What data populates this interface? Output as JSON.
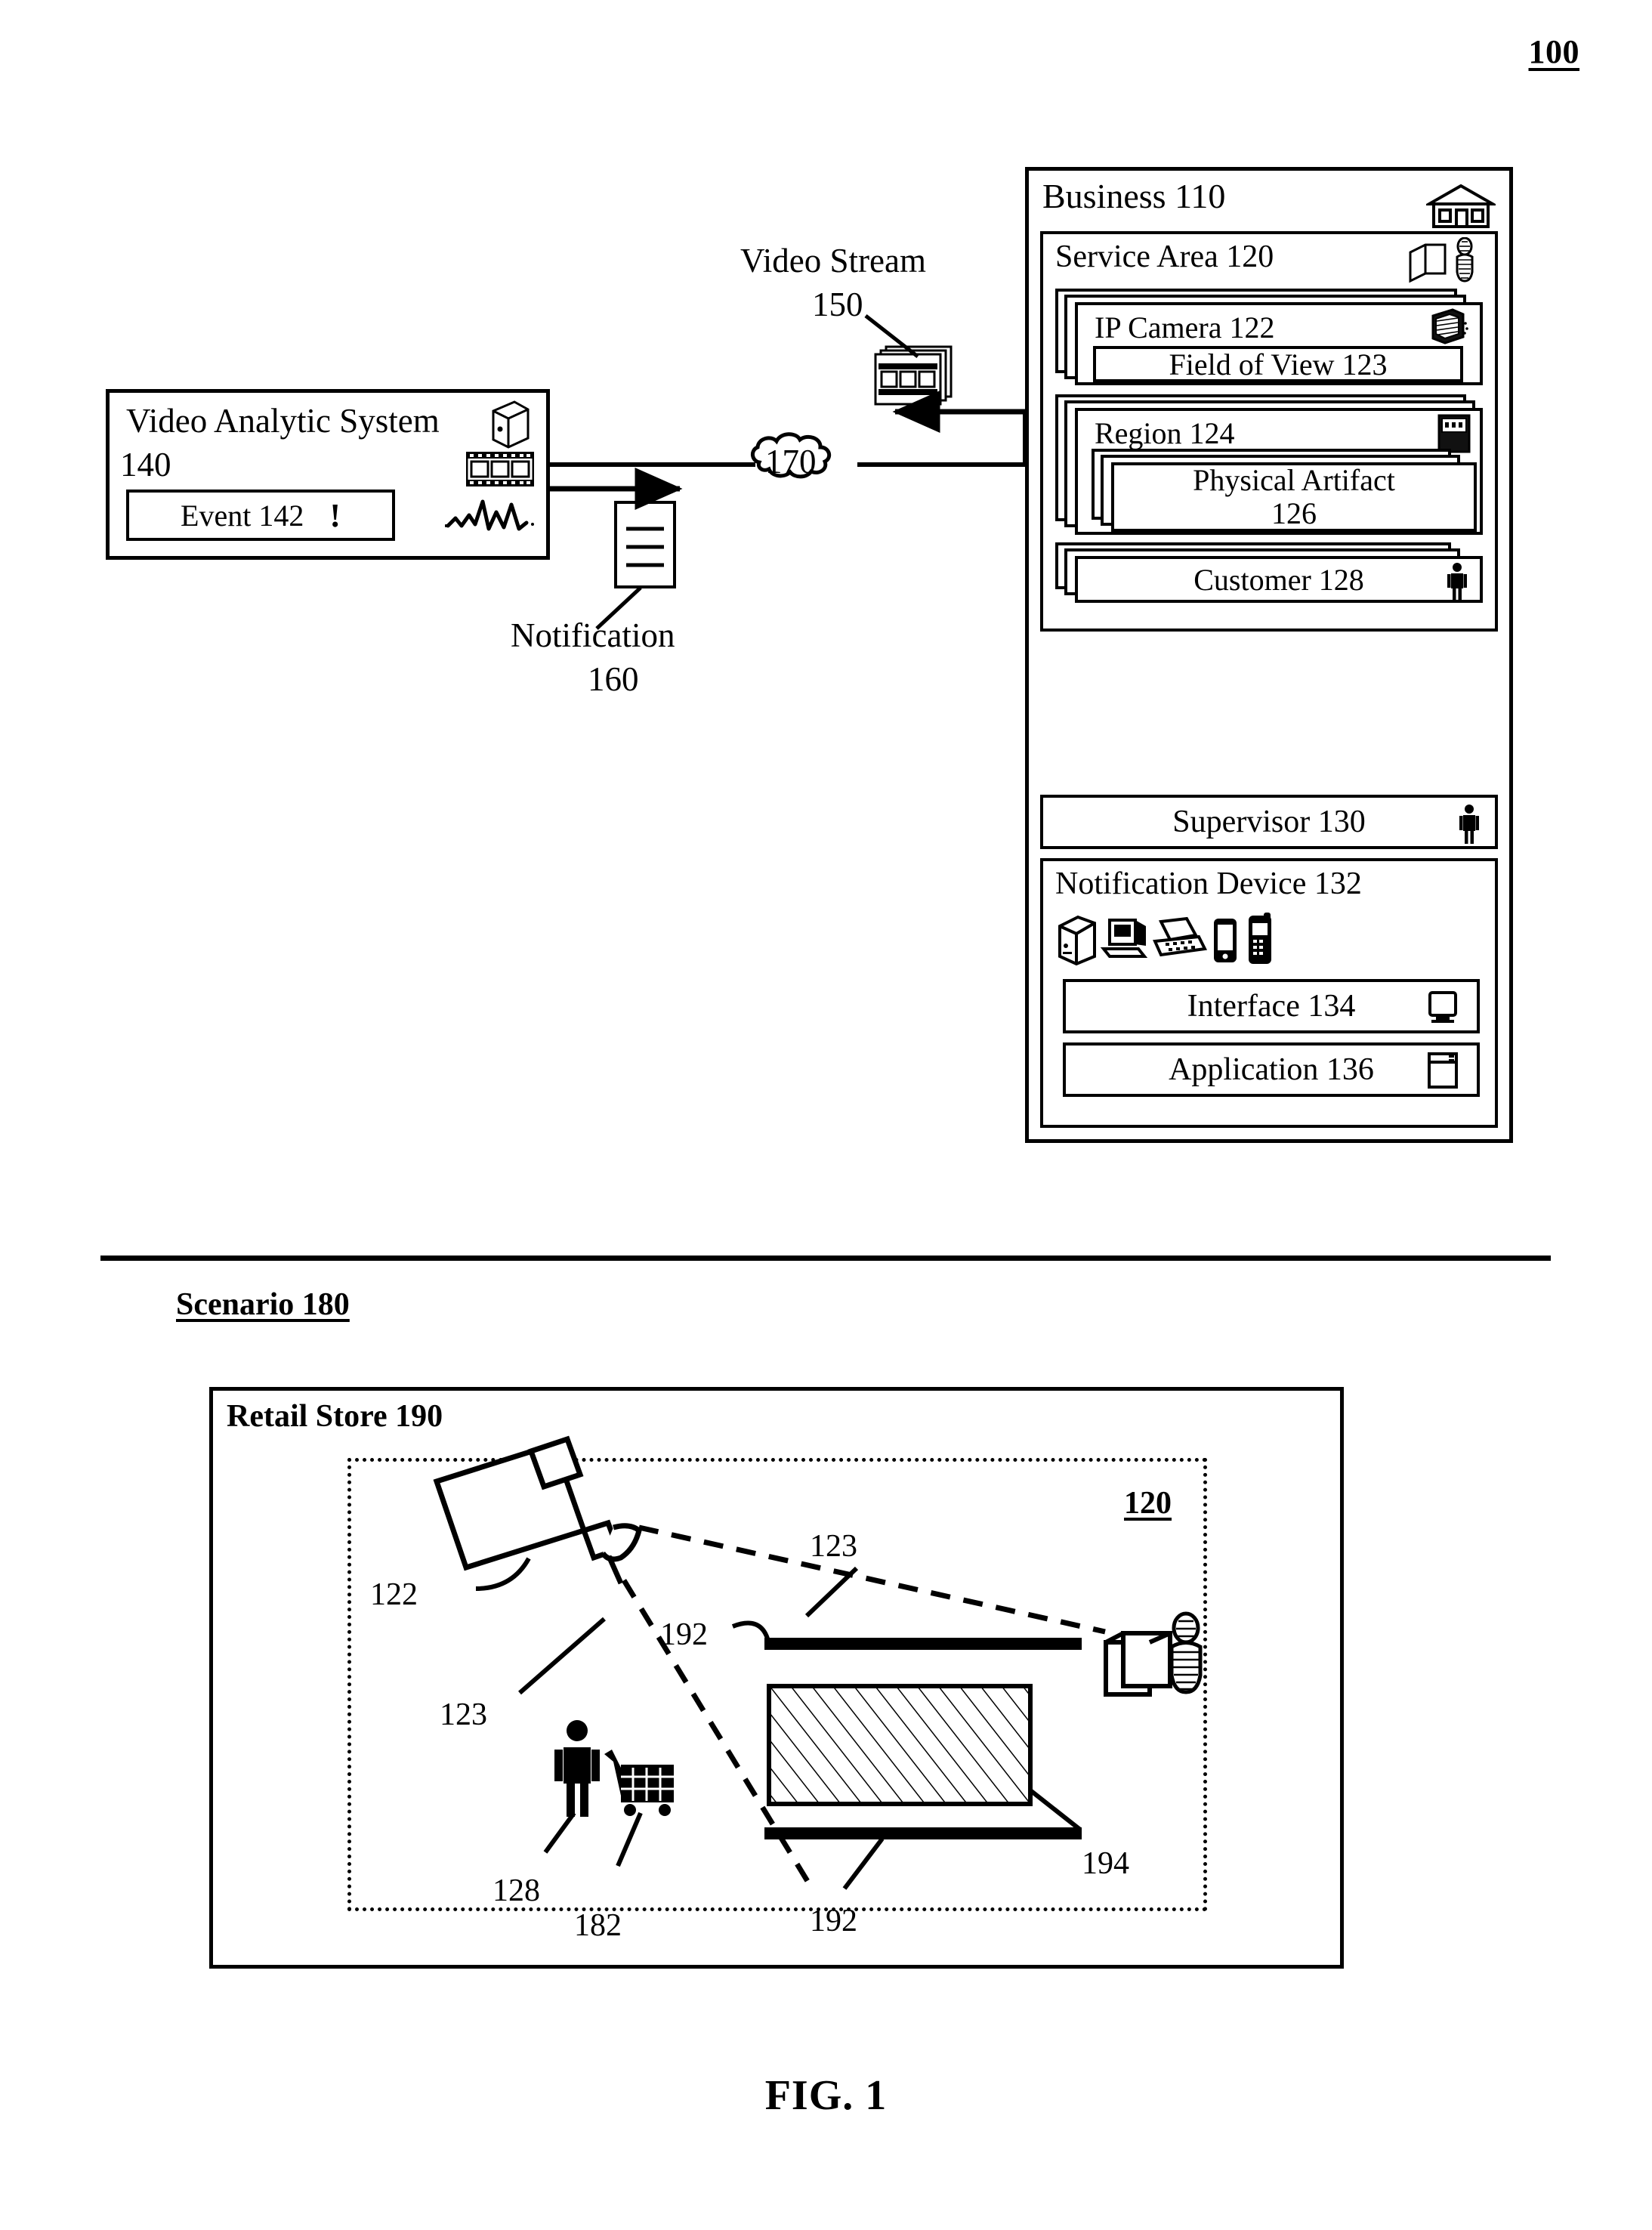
{
  "figure": {
    "number": "100",
    "caption": "FIG. 1"
  },
  "video_analytic_system": {
    "title": "Video Analytic System",
    "ref": "140",
    "event": {
      "label": "Event 142",
      "alert_glyph": "!"
    },
    "icons": [
      "server-icon",
      "film-strip-icon",
      "waveform-icon"
    ]
  },
  "connections": {
    "cloud": "170",
    "video_stream": {
      "label": "Video Stream",
      "ref": "150",
      "icon": "film-frames-icon"
    },
    "notification": {
      "label": "Notification",
      "ref": "160",
      "icon": "document-icon"
    }
  },
  "business": {
    "title": "Business 110",
    "icon": "house-icon",
    "service_area": {
      "title": "Service Area 120",
      "icons": [
        "shelf-icon",
        "person-standing-icon"
      ],
      "cards": [
        {
          "title": "IP Camera 122",
          "icon": "security-camera-icon",
          "inner": "Field of View 123",
          "stacked": true
        },
        {
          "title": "Region 124",
          "icon": "display-case-icon",
          "inner": "Physical Artifact\n126",
          "inner_line1": "Physical Artifact",
          "inner_line2": "126",
          "stacked": true
        },
        {
          "title": "Customer 128",
          "icon": "person-icon",
          "stacked": true
        }
      ]
    },
    "supervisor": {
      "label": "Supervisor 130",
      "icon": "person-icon"
    },
    "notification_device": {
      "title": "Notification Device 132",
      "device_icons": [
        "tower-server-icon",
        "desktop-computer-icon",
        "laptop-icon",
        "pda-icon",
        "mobile-phone-icon"
      ],
      "rows": [
        {
          "label": "Interface 134",
          "icon": "monitor-icon"
        },
        {
          "label": "Application 136",
          "icon": "window-icon"
        }
      ]
    }
  },
  "scenario": {
    "label": "Scenario 180",
    "retail_store": {
      "title": "Retail Store 190",
      "area_ref": "120",
      "annotations": [
        {
          "ref": "122",
          "target": "security-camera"
        },
        {
          "ref": "123",
          "target": "field-of-view-upper-edge"
        },
        {
          "ref": "123",
          "target": "field-of-view-lower-edge"
        },
        {
          "ref": "192",
          "target": "shelf-upper"
        },
        {
          "ref": "192",
          "target": "shelf-lower"
        },
        {
          "ref": "194",
          "target": "hatched-region"
        },
        {
          "ref": "128",
          "target": "customer"
        },
        {
          "ref": "182",
          "target": "shopping-cart"
        }
      ],
      "objects": [
        "security-camera-icon",
        "customer-figure-icon",
        "shopping-cart-icon",
        "hatched-display-region",
        "shelf-bar-upper",
        "shelf-bar-lower",
        "employee-figure-icon",
        "counter-box-icon"
      ]
    }
  },
  "colors": {
    "ink": "#000000",
    "paper": "#ffffff"
  }
}
